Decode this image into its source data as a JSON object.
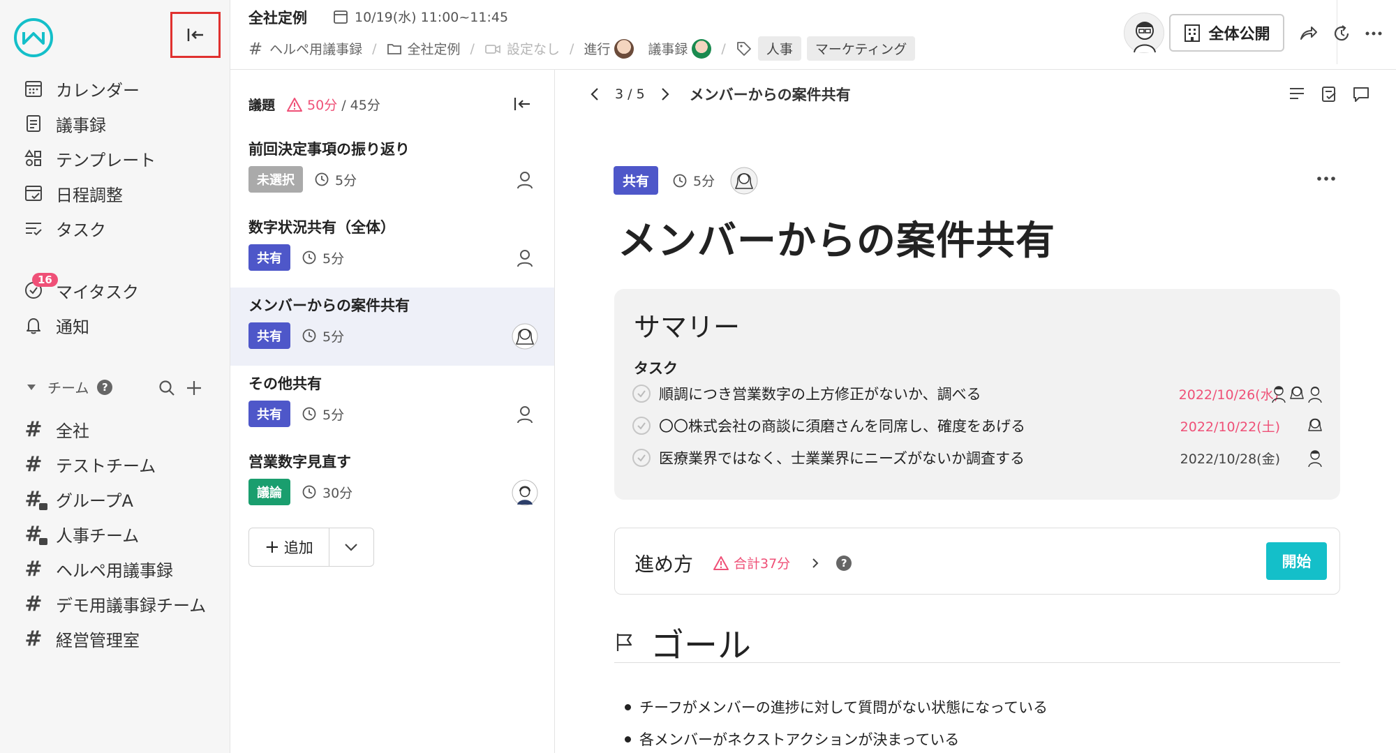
{
  "sidebar": {
    "nav": [
      {
        "label": "カレンダー",
        "icon": "calendar-icon"
      },
      {
        "label": "議事録",
        "icon": "minutes-icon"
      },
      {
        "label": "テンプレート",
        "icon": "template-icon"
      },
      {
        "label": "日程調整",
        "icon": "schedule-icon"
      },
      {
        "label": "タスク",
        "icon": "task-icon"
      }
    ],
    "my_task": {
      "label": "マイタスク",
      "badge": "16"
    },
    "notify": {
      "label": "通知"
    },
    "team_header": "チーム",
    "channels": [
      {
        "label": "全社",
        "locked": false
      },
      {
        "label": "テストチーム",
        "locked": false
      },
      {
        "label": "グループA",
        "locked": true
      },
      {
        "label": "人事チーム",
        "locked": true
      },
      {
        "label": "ヘルペ用議事録",
        "locked": false
      },
      {
        "label": "デモ用議事録チーム",
        "locked": false
      },
      {
        "label": "経営管理室",
        "locked": false
      }
    ]
  },
  "header": {
    "title": "全社定例",
    "datetime": "10/19(水) 11:00~11:45",
    "crumbs": {
      "channel": "ヘルペ用議事録",
      "folder": "全社定例",
      "video": "設定なし",
      "facilitator_label": "進行",
      "minutes_label": "議事録",
      "tags": [
        "人事",
        "マーケティング"
      ]
    },
    "publish_label": "全体公開"
  },
  "agenda": {
    "label": "議題",
    "planned": "50分",
    "total": "/ 45分",
    "items": [
      {
        "title": "前回決定事項の振り返り",
        "tag": "未選択",
        "duration": "5分"
      },
      {
        "title": "数字状況共有（全体）",
        "tag": "共有",
        "duration": "5分"
      },
      {
        "title": "メンバーからの案件共有",
        "tag": "共有",
        "duration": "5分"
      },
      {
        "title": "その他共有",
        "tag": "共有",
        "duration": "5分"
      },
      {
        "title": "営業数字見直す",
        "tag": "議論",
        "duration": "30分"
      }
    ],
    "add_label": "追加"
  },
  "main": {
    "pager": "3 / 5",
    "pager_title": "メンバーからの案件共有",
    "tag": "共有",
    "duration": "5分",
    "title": "メンバーからの案件共有",
    "summary": {
      "heading": "サマリー",
      "sub": "タスク",
      "tasks": [
        {
          "text": "順調につき営業数字の上方修正がないか、調べる",
          "date": "2022/10/26(水)",
          "overdue": true
        },
        {
          "text": "〇〇株式会社の商談に須磨さんを同席し、確度をあげる",
          "date": "2022/10/22(土)",
          "overdue": true
        },
        {
          "text": "医療業界ではなく、士業業界にニーズがないか調査する",
          "date": "2022/10/28(金)",
          "overdue": false
        }
      ]
    },
    "approach": {
      "label": "進め方",
      "warn": "合計37分",
      "start": "開始"
    },
    "goal": {
      "label": "ゴール",
      "bullets": [
        "チーフがメンバーの進捗に対して質問がない状態になっている",
        "各メンバーがネクストアクションが決まっている"
      ]
    }
  },
  "colors": {
    "brand": "#14bfc9",
    "share": "#4e57c9",
    "discussion": "#1a9e6e",
    "warning": "#ef5077"
  }
}
